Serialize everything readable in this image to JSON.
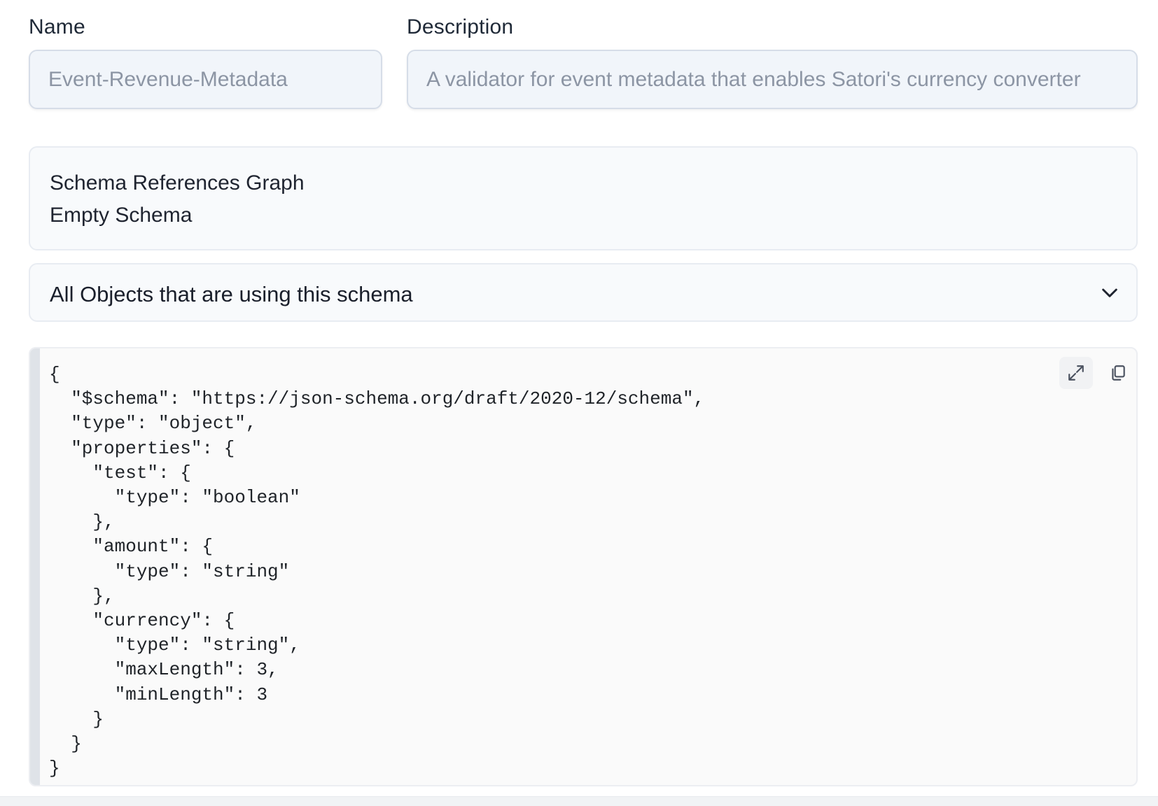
{
  "form": {
    "name": {
      "label": "Name",
      "value": "Event-Revenue-Metadata"
    },
    "description": {
      "label": "Description",
      "value": "A validator for event metadata that enables Satori's currency converter"
    }
  },
  "graph": {
    "title": "Schema References Graph",
    "subtitle": "Empty Schema"
  },
  "objects_accordion": {
    "title": "All Objects that are using this schema",
    "icon": "chevron-down-icon"
  },
  "code_viewer": {
    "icons": {
      "expand": "expand-icon",
      "copy": "copy-icon"
    },
    "code": "{\n  \"$schema\": \"https://json-schema.org/draft/2020-12/schema\",\n  \"type\": \"object\",\n  \"properties\": {\n    \"test\": {\n      \"type\": \"boolean\"\n    },\n    \"amount\": {\n      \"type\": \"string\"\n    },\n    \"currency\": {\n      \"type\": \"string\",\n      \"maxLength\": 3,\n      \"minLength\": 3\n    }\n  }\n}"
  },
  "colors": {
    "input_bg": "#f1f5fa",
    "input_border": "#d6dde8",
    "input_text": "#8c95a4",
    "card_bg": "#f8fafc",
    "code_bg": "#fafafa",
    "gutter": "#dfe3e8"
  }
}
